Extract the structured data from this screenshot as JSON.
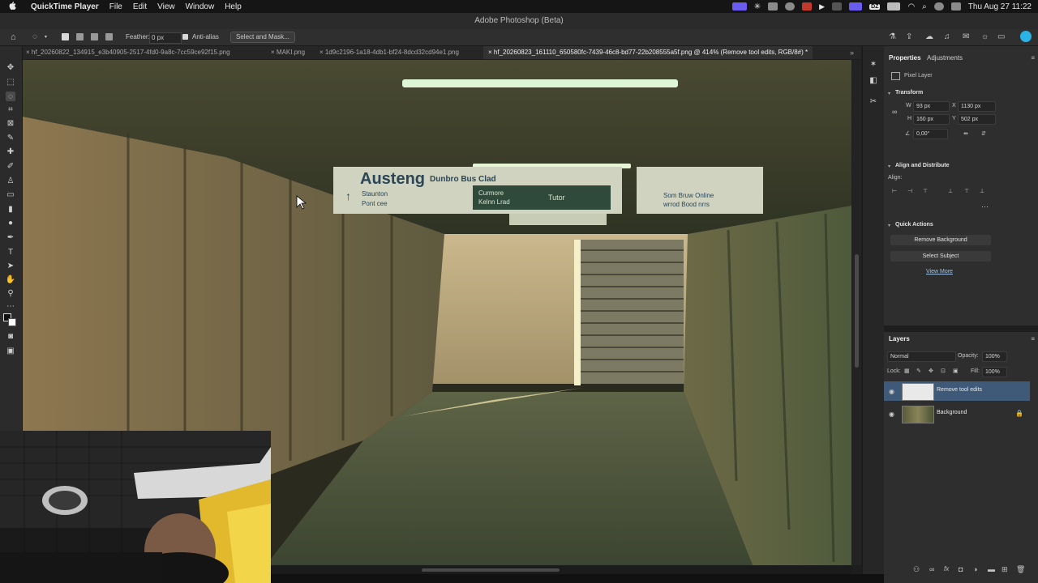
{
  "menubar": {
    "app": "QuickTime Player",
    "menus": [
      "File",
      "Edit",
      "View",
      "Window",
      "Help"
    ],
    "status_icons": [
      "screen-record-icon",
      "brightness-icon",
      "cloud-icon",
      "creative-cloud-icon",
      "app-icon",
      "play-icon",
      "box-icon",
      "mirror-icon",
      "dz-icon",
      "battery-icon",
      "wifi-icon",
      "search-icon",
      "user-icon",
      "control-center-icon"
    ],
    "dz_label": "DZ",
    "datetime": "Thu Aug 27  11:22"
  },
  "window_title": "Adobe Photoshop (Beta)",
  "options": {
    "feather_label": "Feather:",
    "feather_value": "0 px",
    "antialias_label": "Anti-alias",
    "select_mask_label": "Select and Mask..."
  },
  "tabs": [
    {
      "label": "hf_20260822_134915_e3b40905-2517-4fd0-9a8c-7cc59ce92f15.png"
    },
    {
      "label": "MAKI.png"
    },
    {
      "label": "1d9c2196-1a18-4db1-bf24-8dcd32cd94e1.png"
    },
    {
      "label": "hf_20260823_161110_650580fc-7439-46c8-bd77-22b208555a5f.png @ 414% (Remove tool edits, RGB/8#) *"
    }
  ],
  "properties": {
    "tab_properties": "Properties",
    "tab_adjustments": "Adjustments",
    "layer_kind": "Pixel Layer",
    "transform_header": "Transform",
    "w_label": "W",
    "w_value": "93 px",
    "x_label": "X",
    "x_value": "1130 px",
    "h_label": "H",
    "h_value": "160 px",
    "y_label": "Y",
    "y_value": "502 px",
    "angle_value": "0,00°",
    "align_header": "Align and Distribute",
    "align_label": "Align:",
    "quick_header": "Quick Actions",
    "remove_bg": "Remove Background",
    "select_subject": "Select Subject",
    "view_more": "View More"
  },
  "layers": {
    "title": "Layers",
    "blend_mode": "Normal",
    "opacity_label": "Opacity:",
    "opacity_value": "100%",
    "lock_label": "Lock:",
    "fill_label": "Fill:",
    "fill_value": "100%",
    "items": [
      {
        "name": "Remove tool edits"
      },
      {
        "name": "Background"
      }
    ]
  },
  "canvas": {
    "sign_main": "Austeng",
    "sign_sub": "Dunbro Bus Clad",
    "sign_left_a": "Staunton",
    "sign_left_b": "Pont cee",
    "sign_mid_a": "Curmore",
    "sign_mid_b": "Kelnn Lrad",
    "sign_right_a": "Tutor",
    "sign_far_a": "Som Bruw Online",
    "sign_far_b": "wrrod Bood nrrs"
  },
  "colors": {
    "accent": "#3f5a78",
    "menubar_bg": "#151515",
    "panel_bg": "#2e2e2e"
  }
}
